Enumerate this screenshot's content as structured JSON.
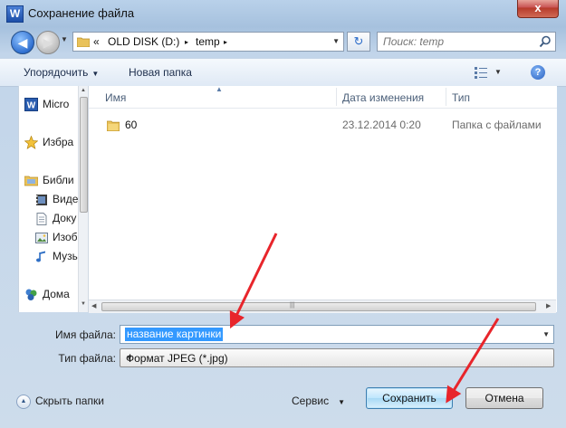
{
  "window": {
    "title": "Сохранение файла",
    "app_icon_letter": "W",
    "close_symbol": "x"
  },
  "address": {
    "overflow": "«",
    "crumbs": [
      "OLD DISK (D:)",
      "temp"
    ],
    "separator": "▸"
  },
  "search": {
    "placeholder": "Поиск: temp"
  },
  "toolbar": {
    "organize_label": "Упорядочить",
    "new_folder_label": "Новая папка",
    "help_symbol": "?"
  },
  "navpane": {
    "items": [
      {
        "label": "Micro",
        "icon": "word-icon"
      },
      {
        "label": "Избра",
        "icon": "star-icon"
      },
      {
        "label": "Библи",
        "icon": "library-icon"
      },
      {
        "label": "Виде",
        "icon": "video-icon"
      },
      {
        "label": "Доку",
        "icon": "document-icon"
      },
      {
        "label": "Изоб",
        "icon": "image-icon"
      },
      {
        "label": "Музы",
        "icon": "music-icon"
      },
      {
        "label": "Дома",
        "icon": "homegroup-icon"
      }
    ]
  },
  "filelist": {
    "columns": {
      "name": "Имя",
      "date": "Дата изменения",
      "type": "Тип"
    },
    "rows": [
      {
        "name": "60",
        "date": "23.12.2014 0:20",
        "type": "Папка с файлами"
      }
    ]
  },
  "form": {
    "filename_label": "Имя файла:",
    "filename_value": "название картинки",
    "filetype_label": "Тип файла:",
    "filetype_value": "Формат JPEG (*.jpg)"
  },
  "bottom": {
    "hide_folders_label": "Скрыть папки",
    "service_label": "Сервис",
    "save_label": "Сохранить",
    "cancel_label": "Отмена"
  },
  "colors": {
    "annotation_arrow": "#e8252b",
    "selection": "#3399ff",
    "folder": "#e9c25a"
  }
}
